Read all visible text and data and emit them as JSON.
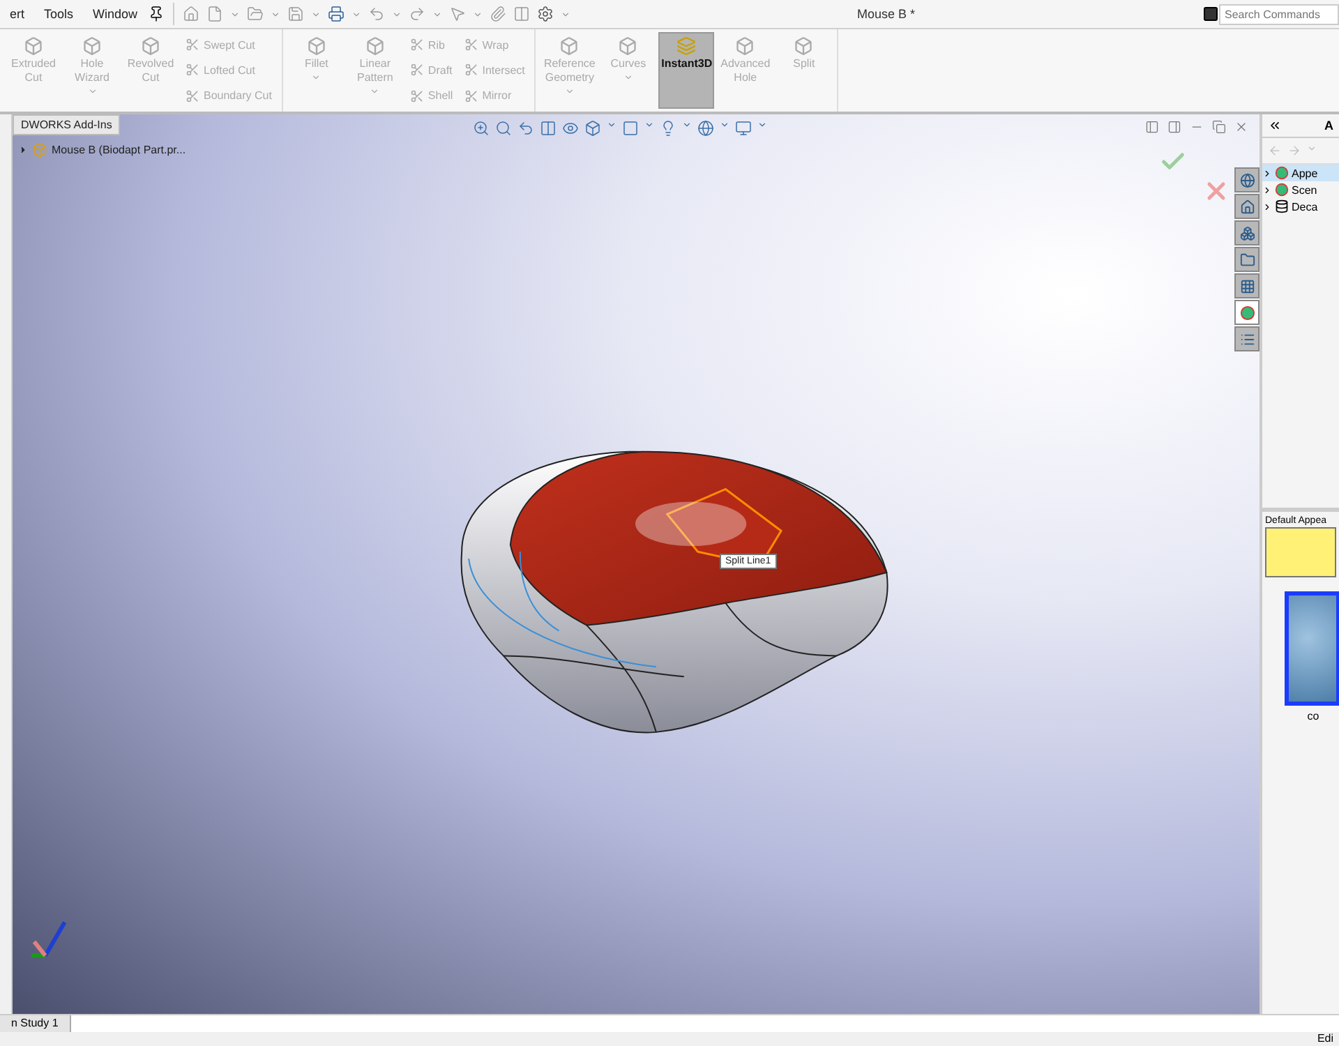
{
  "menu": [
    {
      "label": "ert"
    },
    {
      "label": "Tools"
    },
    {
      "label": "Window"
    }
  ],
  "title": "Mouse B *",
  "search": {
    "placeholder": "Search Commands"
  },
  "ribbon": {
    "groups": [
      {
        "columns": [
          {
            "kind": "large",
            "label": "Extruded Cut",
            "disabled": true,
            "selected": false,
            "dropdown": false
          },
          {
            "kind": "large",
            "label": "Hole Wizard",
            "disabled": true,
            "selected": false,
            "dropdown": true
          },
          {
            "kind": "large",
            "label": "Revolved Cut",
            "disabled": true,
            "selected": false,
            "dropdown": false
          },
          {
            "kind": "stack",
            "items": [
              {
                "label": "Swept Cut",
                "disabled": true
              },
              {
                "label": "Lofted Cut",
                "disabled": true
              },
              {
                "label": "Boundary Cut",
                "disabled": true
              }
            ]
          }
        ]
      },
      {
        "columns": [
          {
            "kind": "large",
            "label": "Fillet",
            "disabled": true,
            "selected": false,
            "dropdown": true
          },
          {
            "kind": "large",
            "label": "Linear Pattern",
            "disabled": true,
            "selected": false,
            "dropdown": true
          },
          {
            "kind": "stack",
            "items": [
              {
                "label": "Rib",
                "disabled": true
              },
              {
                "label": "Draft",
                "disabled": true
              },
              {
                "label": "Shell",
                "disabled": true
              }
            ]
          },
          {
            "kind": "stack",
            "items": [
              {
                "label": "Wrap",
                "disabled": true
              },
              {
                "label": "Intersect",
                "disabled": true
              },
              {
                "label": "Mirror",
                "disabled": true
              }
            ]
          }
        ]
      },
      {
        "columns": [
          {
            "kind": "large",
            "label": "Reference Geometry",
            "disabled": true,
            "selected": false,
            "dropdown": true
          },
          {
            "kind": "large",
            "label": "Curves",
            "disabled": true,
            "selected": false,
            "dropdown": true
          },
          {
            "kind": "large",
            "label": "Instant3D",
            "disabled": false,
            "selected": true,
            "dropdown": false
          },
          {
            "kind": "large",
            "label": "Advanced Hole",
            "disabled": true,
            "selected": false,
            "dropdown": false
          },
          {
            "kind": "large",
            "label": "Split",
            "disabled": true,
            "selected": false,
            "dropdown": false
          }
        ]
      }
    ]
  },
  "addins_tab": "DWORKS Add-Ins",
  "feature_tree": {
    "label": "Mouse B  (Biodapt Part.pr...",
    "expanded": false
  },
  "tooltip": "Split Line1",
  "task_tabs": [
    {
      "kind": "resources",
      "selected": false
    },
    {
      "kind": "home",
      "selected": false
    },
    {
      "kind": "parts",
      "selected": false
    },
    {
      "kind": "folder",
      "selected": false
    },
    {
      "kind": "palette",
      "selected": false
    },
    {
      "kind": "appearances",
      "selected": true
    },
    {
      "kind": "properties",
      "selected": false
    }
  ],
  "task_pane": {
    "title": "A",
    "tree": [
      {
        "label": "Appe",
        "selected": true
      },
      {
        "label": "Scen",
        "selected": false
      },
      {
        "label": "Deca",
        "selected": false
      }
    ],
    "swatch_label": "Default Appea",
    "thumbnail": {
      "caption": "co",
      "selected": true
    }
  },
  "bottom_tab": "n Study 1",
  "status": "Edi"
}
